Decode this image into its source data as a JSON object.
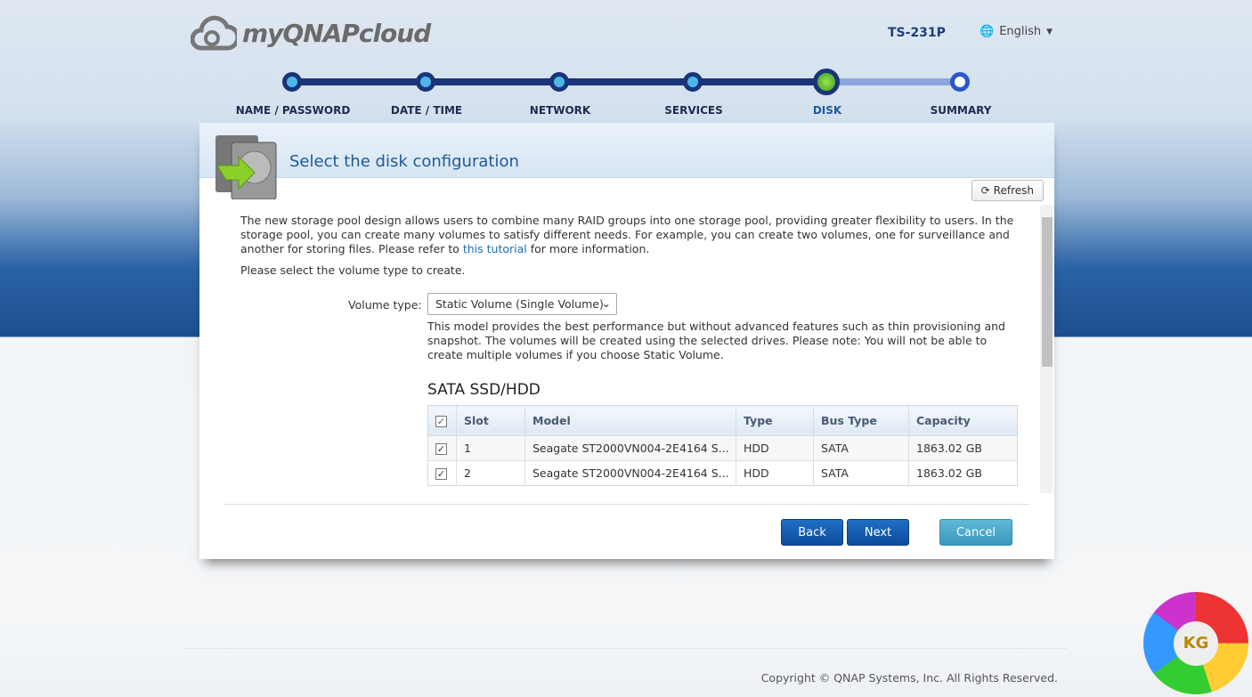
{
  "header": {
    "logo": "myQNAPcloud",
    "model": "TS-231P",
    "language": "English"
  },
  "steps": [
    {
      "label": "NAME / PASSWORD",
      "state": "done"
    },
    {
      "label": "DATE / TIME",
      "state": "done"
    },
    {
      "label": "NETWORK",
      "state": "done"
    },
    {
      "label": "SERVICES",
      "state": "done"
    },
    {
      "label": "DISK",
      "state": "current"
    },
    {
      "label": "SUMMARY",
      "state": "pending"
    }
  ],
  "panel": {
    "title": "Select the disk configuration",
    "refresh": "Refresh",
    "intro_a": "The new storage pool design allows users to combine many RAID groups into one storage pool, providing greater flexibility to users. In the storage pool, you can create many volumes to satisfy different needs. For example, you can create two volumes, one for surveillance and another for storing files. Please refer to ",
    "intro_link": "this tutorial",
    "intro_b": " for more information.",
    "select_prompt": "Please select the volume type to create.",
    "volume_type_label": "Volume type:",
    "volume_type_value": "Static Volume (Single Volume)",
    "volume_desc": "This model provides the best performance but without advanced features such as thin provisioning and snapshot. The volumes will be created using the selected drives. Please note: You will not be able to create multiple volumes if you choose Static Volume.",
    "section": "SATA SSD/HDD",
    "columns": [
      "Slot",
      "Model",
      "Type",
      "Bus Type",
      "Capacity"
    ],
    "rows": [
      {
        "slot": "1",
        "model": "Seagate ST2000VN004-2E4164 S...",
        "type": "HDD",
        "bus": "SATA",
        "capacity": "1863.02 GB",
        "checked": true
      },
      {
        "slot": "2",
        "model": "Seagate ST2000VN004-2E4164 S...",
        "type": "HDD",
        "bus": "SATA",
        "capacity": "1863.02 GB",
        "checked": true
      }
    ],
    "back": "Back",
    "next": "Next",
    "cancel": "Cancel"
  },
  "footer": "Copyright © QNAP Systems, Inc. All Rights Reserved.",
  "watermark": "KG"
}
